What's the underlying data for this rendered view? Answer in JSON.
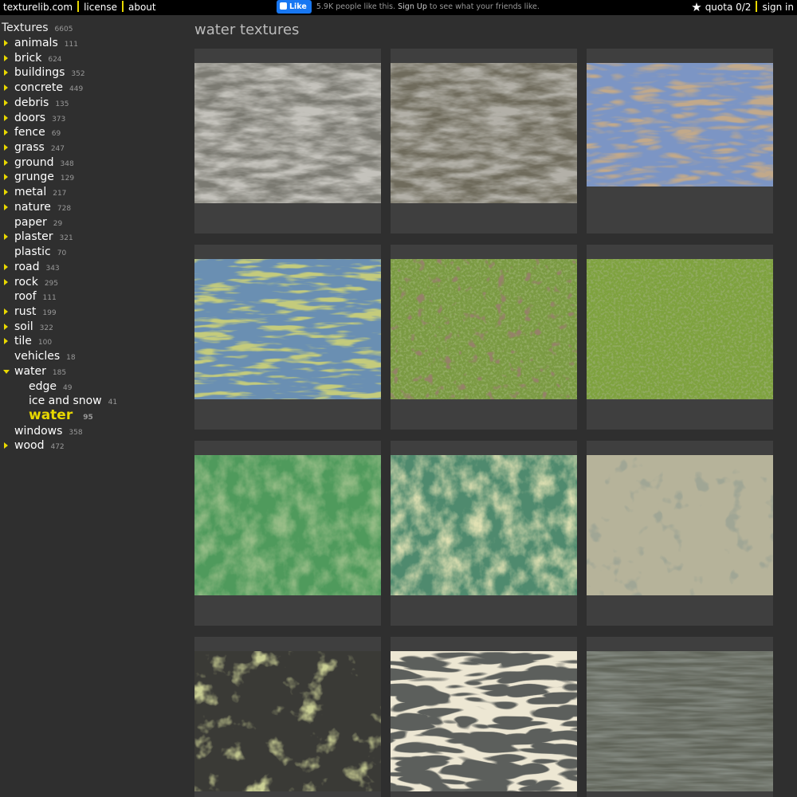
{
  "topbar": {
    "site": "texturelib.com",
    "license": "license",
    "about": "about",
    "fb_like": "Like",
    "fb_text_prefix": "5.9K people like this.",
    "fb_signup": "Sign Up",
    "fb_text_suffix": "to see what your friends like.",
    "quota": "quota 0/2",
    "signin": "sign in"
  },
  "sidebar": {
    "root": {
      "label": "Textures",
      "count": "6605"
    },
    "items": [
      {
        "label": "animals",
        "count": "111",
        "arrow": true
      },
      {
        "label": "brick",
        "count": "624",
        "arrow": true
      },
      {
        "label": "buildings",
        "count": "352",
        "arrow": true
      },
      {
        "label": "concrete",
        "count": "449",
        "arrow": true
      },
      {
        "label": "debris",
        "count": "135",
        "arrow": true
      },
      {
        "label": "doors",
        "count": "373",
        "arrow": true
      },
      {
        "label": "fence",
        "count": "69",
        "arrow": true
      },
      {
        "label": "grass",
        "count": "247",
        "arrow": true
      },
      {
        "label": "ground",
        "count": "348",
        "arrow": true
      },
      {
        "label": "grunge",
        "count": "129",
        "arrow": true
      },
      {
        "label": "metal",
        "count": "217",
        "arrow": true
      },
      {
        "label": "nature",
        "count": "728",
        "arrow": true
      },
      {
        "label": "paper",
        "count": "29",
        "arrow": false
      },
      {
        "label": "plaster",
        "count": "321",
        "arrow": true
      },
      {
        "label": "plastic",
        "count": "70",
        "arrow": false
      },
      {
        "label": "road",
        "count": "343",
        "arrow": true
      },
      {
        "label": "rock",
        "count": "295",
        "arrow": true
      },
      {
        "label": "roof",
        "count": "111",
        "arrow": false
      },
      {
        "label": "rust",
        "count": "199",
        "arrow": true
      },
      {
        "label": "soil",
        "count": "322",
        "arrow": true
      },
      {
        "label": "tile",
        "count": "100",
        "arrow": true
      },
      {
        "label": "vehicles",
        "count": "18",
        "arrow": false
      },
      {
        "label": "water",
        "count": "185",
        "arrow": "down"
      },
      {
        "label": "edge",
        "count": "49",
        "sub": true
      },
      {
        "label": "ice and snow",
        "count": "41",
        "sub": true
      },
      {
        "label": "water",
        "count": "95",
        "sub": true,
        "active": true
      },
      {
        "label": "windows",
        "count": "358",
        "arrow": false
      },
      {
        "label": "wood",
        "count": "472",
        "arrow": true
      }
    ]
  },
  "main": {
    "title": "water textures"
  },
  "colors": {
    "accent": "#e8d800",
    "background": "#2f2f2f",
    "tile": "#3f3f3f"
  }
}
